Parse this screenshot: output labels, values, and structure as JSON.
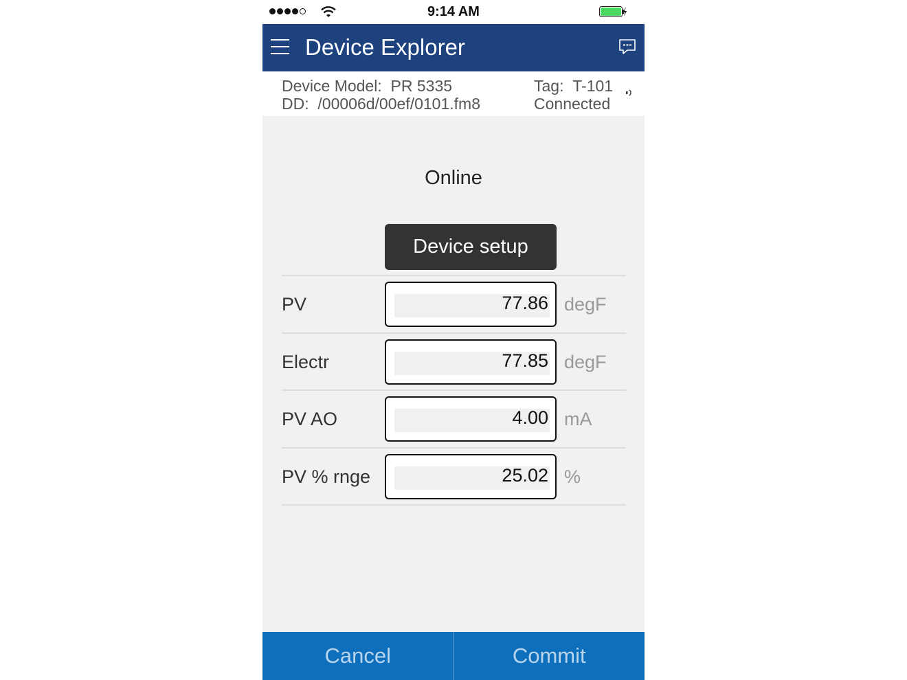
{
  "status_bar": {
    "time": "9:14 AM",
    "signal_bars_filled": 4,
    "signal_bars_total": 5,
    "battery_level": 1.0
  },
  "nav": {
    "title": "Device Explorer",
    "menu_icon": "hamburger-menu-icon",
    "right_icon": "chat-bubble-icon",
    "color": "#1d427e"
  },
  "info": {
    "model_label": "Device Model:",
    "model_value": "PR 5335",
    "dd_label": "DD:",
    "dd_value": "/00006d/00ef/0101.fm8",
    "tag_label": "Tag:",
    "tag_value": "T-101",
    "connection_status": "Connected"
  },
  "page": {
    "title": "Online",
    "setup_button": "Device setup"
  },
  "rows": [
    {
      "label": "PV",
      "value": "77.86",
      "unit": "degF"
    },
    {
      "label": "Electr",
      "value": "77.85",
      "unit": "degF"
    },
    {
      "label": "PV AO",
      "value": "4.00",
      "unit": "mA"
    },
    {
      "label": "PV % rnge",
      "value": "25.02",
      "unit": "%"
    }
  ],
  "bottom": {
    "cancel": "Cancel",
    "commit": "Commit",
    "color": "#0e70bd"
  }
}
